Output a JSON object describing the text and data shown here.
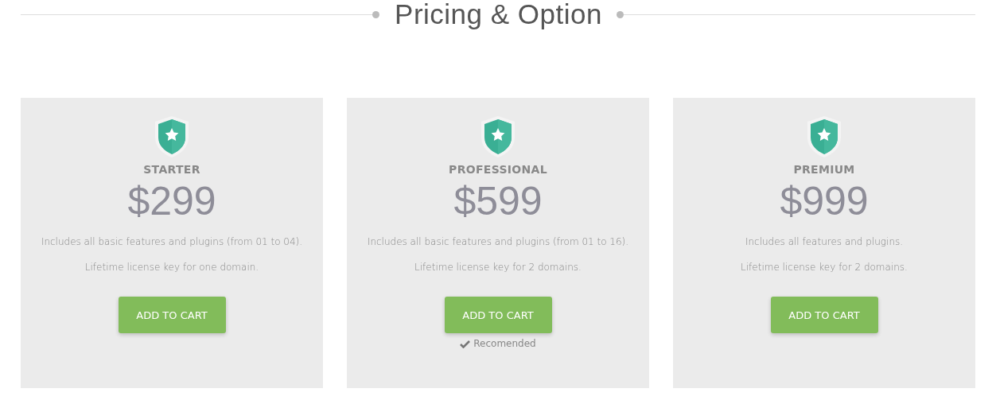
{
  "heading": "Pricing & Option",
  "plans": [
    {
      "name": "STARTER",
      "price": "$299",
      "features": [
        "Includes all basic features and plugins (from 01 to 04).",
        "Lifetime license key for one domain."
      ],
      "button": "ADD TO CART",
      "recommended": false
    },
    {
      "name": "PROFESSIONAL",
      "price": "$599",
      "features": [
        "Includes all basic features and plugins (from 01 to 16).",
        "Lifetime license key for 2 domains."
      ],
      "button": "ADD TO CART",
      "recommended": true,
      "note": "Recomended"
    },
    {
      "name": "PREMIUM",
      "price": "$999",
      "features": [
        "Includes all features and plugins.",
        "Lifetime license key for 2 domains."
      ],
      "button": "ADD TO CART",
      "recommended": false
    }
  ]
}
